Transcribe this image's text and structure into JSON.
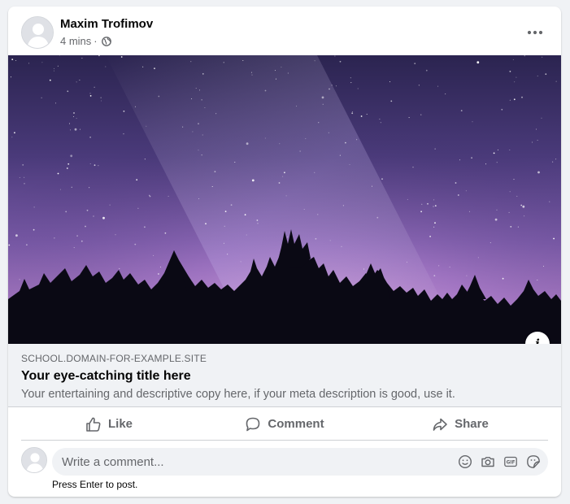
{
  "post": {
    "author_name": "Maxim Trofimov",
    "timestamp": "4 mins",
    "separator": "·",
    "audience_icon": "globe-icon",
    "menu_icon": "more-horizontal-icon"
  },
  "link_preview": {
    "domain": "SCHOOL.DOMAIN-FOR-EXAMPLE.SITE",
    "title": "Your eye-catching title here",
    "description": "Your entertaining and descriptive copy here, if your meta description is good, use it.",
    "info_label": "i"
  },
  "actions": {
    "like_label": "Like",
    "comment_label": "Comment",
    "share_label": "Share"
  },
  "comment": {
    "placeholder": "Write a comment...",
    "hint": "Press Enter to post.",
    "icons": [
      "emoji-icon",
      "camera-icon",
      "gif-icon",
      "sticker-icon"
    ]
  },
  "colors": {
    "card_bg": "#ffffff",
    "page_bg": "#f0f2f5",
    "secondary_text": "#65676b",
    "primary_text": "#050505"
  }
}
